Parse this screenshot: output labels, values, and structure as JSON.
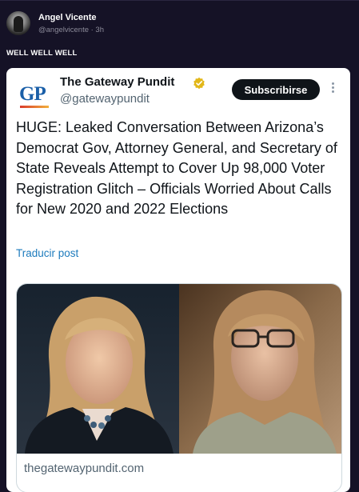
{
  "outer_post": {
    "user_name": "Angel Vicente",
    "handle_time": "@angelvicente · 3h",
    "text": "WELL WELL WELL"
  },
  "embedded_post": {
    "account_name": "The Gateway Pundit",
    "handle": "@gatewaypundit",
    "logo_text": "GP",
    "subscribe_label": "Subscribirse",
    "text": "HUGE: Leaked Conversation Between Arizona’s Democrat Gov, Attorney General, and Secretary of State Reveals Attempt to Cover Up 98,000 Voter Registration Glitch – Officials Worried About Calls for New 2020 and 2022 Elections",
    "translate_label": "Traducir post",
    "link_domain": "thegatewaypundit.com"
  },
  "colors": {
    "background": "#151226",
    "card": "#ffffff",
    "link_blue": "#1d7bbd",
    "logo_blue": "#1a5fa8",
    "verified_gold": "#e2b719"
  },
  "icons": {
    "verified": "verified-badge-icon",
    "more": "more-options-icon"
  }
}
